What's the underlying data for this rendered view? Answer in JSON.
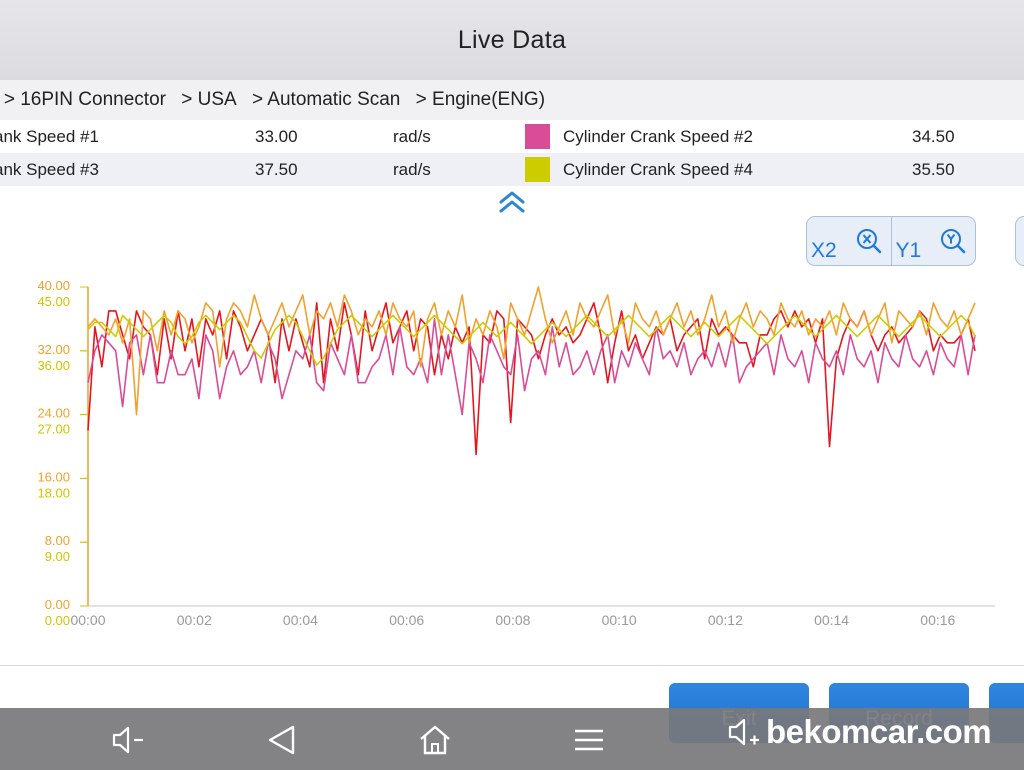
{
  "title": "Live Data",
  "breadcrumb": [
    "0 > 16PIN Connector",
    "> USA",
    "> Automatic Scan",
    "> Engine(ENG)"
  ],
  "rows": [
    {
      "left_name": "ank Speed #1",
      "left_value": "33.00",
      "left_unit": "rad/s",
      "right_color": "#d94c96",
      "right_name": "Cylinder Crank Speed #2",
      "right_value": "34.50"
    },
    {
      "left_name": "ank Speed #3",
      "left_value": "37.50",
      "left_unit": "rad/s",
      "right_color": "#cccc00",
      "right_name": "Cylinder Crank Speed #4",
      "right_value": "35.50"
    }
  ],
  "zoom": {
    "x_label": "X2",
    "y_label": "Y1"
  },
  "buttons": {
    "exit": "Exit",
    "record": "Record"
  },
  "watermark": "bekomcar.com",
  "chart_data": {
    "type": "line",
    "x_tick_labels": [
      "00:00",
      "00:02",
      "00:04",
      "00:06",
      "00:08",
      "00:10",
      "00:12",
      "00:14",
      "00:16"
    ],
    "xlim": [
      0,
      16.7
    ],
    "y_axes": [
      {
        "color": "#f2a12e",
        "ticks": [
          "0.00",
          "8.00",
          "16.00",
          "24.00",
          "32.00",
          "40.00"
        ],
        "ylim": [
          0,
          40
        ]
      },
      {
        "color": "#d2c400",
        "ticks": [
          "0.00",
          "9.00",
          "18.00",
          "27.00",
          "36.00",
          "45.00"
        ],
        "ylim": [
          0,
          45
        ]
      }
    ],
    "series": [
      {
        "color": "#e5161f",
        "axis": 0,
        "values": [
          22,
          35,
          30,
          37,
          37,
          34,
          31,
          37,
          35,
          34,
          29,
          36,
          31,
          37,
          32,
          36,
          30,
          36,
          34,
          37,
          31,
          37,
          35,
          32,
          34,
          36,
          34,
          28,
          36,
          32,
          36,
          33,
          30,
          38,
          28,
          36,
          32,
          38,
          34,
          29,
          37,
          32,
          35,
          38,
          33,
          35,
          37,
          32,
          36,
          35,
          29,
          34,
          31,
          35,
          33,
          35,
          19,
          34,
          33,
          37,
          36,
          23,
          36,
          35,
          34,
          31,
          34,
          36,
          34,
          35,
          33,
          34,
          36,
          38,
          34,
          28,
          33,
          37,
          32,
          34,
          31,
          33,
          35,
          34,
          36,
          32,
          34,
          35,
          36,
          31,
          36,
          34,
          35,
          34,
          33,
          33,
          30,
          34,
          34,
          36,
          37,
          35,
          37,
          35,
          36,
          33,
          36,
          20,
          31,
          34,
          36,
          35,
          37,
          34,
          32,
          34,
          35,
          33,
          34,
          35,
          37,
          36,
          32,
          34,
          33,
          33,
          34,
          36,
          32
        ]
      },
      {
        "color": "#d94c96",
        "axis": 0,
        "values": [
          28,
          32,
          34,
          33,
          32,
          25,
          33,
          34,
          29,
          34,
          28,
          28,
          32,
          29,
          29,
          31,
          26,
          34,
          32,
          26,
          30,
          32,
          29,
          30,
          32,
          28,
          33,
          31,
          26,
          29,
          32,
          31,
          34,
          28,
          27,
          33,
          31,
          29,
          34,
          28,
          28,
          30,
          31,
          34,
          29,
          35,
          30,
          29,
          31,
          28,
          36,
          29,
          34,
          29,
          24,
          33,
          31,
          28,
          34,
          32,
          30,
          29,
          34,
          27,
          31,
          32,
          29,
          35,
          30,
          33,
          29,
          30,
          32,
          29,
          32,
          34,
          28,
          32,
          30,
          33,
          31,
          29,
          35,
          31,
          32,
          30,
          33,
          29,
          31,
          32,
          30,
          33,
          30,
          34,
          28,
          30,
          31,
          32,
          33,
          29,
          34,
          31,
          30,
          32,
          28,
          33,
          31,
          30,
          32,
          29,
          34,
          31,
          30,
          32,
          28,
          33,
          31,
          30,
          34,
          31,
          30,
          32,
          29,
          33,
          31,
          30,
          34,
          29,
          34
        ]
      },
      {
        "color": "#f2a12e",
        "axis": 0,
        "values": [
          35,
          36,
          35,
          34,
          36,
          33,
          36,
          24,
          37,
          36,
          32,
          37,
          34,
          37,
          36,
          33,
          35,
          38,
          37,
          30,
          36,
          38,
          37,
          35,
          39,
          36,
          34,
          36,
          38,
          35,
          37,
          39,
          34,
          37,
          36,
          38,
          35,
          39,
          37,
          34,
          36,
          35,
          37,
          34,
          38,
          36,
          35,
          37,
          30,
          36,
          38,
          34,
          37,
          35,
          39,
          33,
          36,
          34,
          37,
          35,
          31,
          38,
          36,
          34,
          37,
          40,
          36,
          33,
          35,
          37,
          34,
          38,
          36,
          35,
          37,
          39,
          34,
          36,
          33,
          38,
          36,
          35,
          37,
          34,
          36,
          38,
          35,
          37,
          34,
          36,
          39,
          35,
          37,
          33,
          36,
          38,
          35,
          37,
          36,
          34,
          38,
          36,
          35,
          37,
          34,
          36,
          35,
          37,
          34,
          38,
          36,
          35,
          37,
          34,
          36,
          38,
          33,
          37,
          36,
          35,
          37,
          34,
          38,
          36,
          35,
          37,
          34,
          36,
          38
        ]
      },
      {
        "color": "#cccc00",
        "axis": 1,
        "values": [
          39,
          40,
          40,
          39,
          38,
          41,
          40,
          39,
          38,
          39,
          40,
          41,
          40,
          38,
          37,
          38,
          40,
          41,
          40,
          39,
          40,
          41,
          40,
          38,
          36,
          35,
          37,
          39,
          40,
          41,
          40,
          38,
          36,
          34,
          35,
          37,
          39,
          40,
          41,
          40,
          39,
          38,
          39,
          40,
          41,
          40,
          39,
          38,
          39,
          40,
          41,
          40,
          39,
          38,
          37,
          38,
          39,
          40,
          39,
          38,
          39,
          40,
          39,
          38,
          37,
          38,
          39,
          40,
          39,
          38,
          39,
          40,
          41,
          40,
          39,
          38,
          39,
          40,
          41,
          40,
          39,
          38,
          39,
          40,
          41,
          40,
          39,
          38,
          39,
          40,
          39,
          38,
          39,
          40,
          41,
          40,
          39,
          38,
          37,
          38,
          39,
          40,
          41,
          40,
          39,
          38,
          39,
          40,
          41,
          40,
          39,
          38,
          39,
          40,
          41,
          40,
          39,
          38,
          39,
          40,
          41,
          40,
          39,
          38,
          39,
          40,
          41,
          40,
          38
        ]
      }
    ]
  }
}
